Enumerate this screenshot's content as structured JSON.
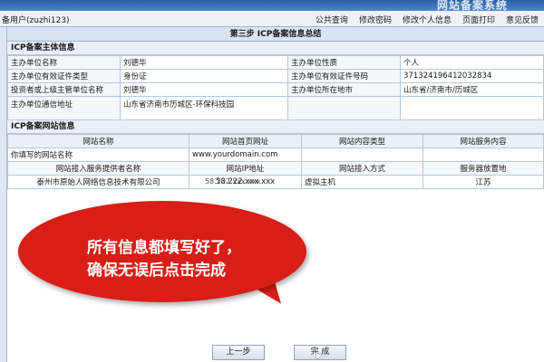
{
  "banner": {
    "title": "网站备案系统"
  },
  "userbar": {
    "user_label": "备用户(zuzhi123)",
    "links": [
      "公共查询",
      "修改密码",
      "修改个人信息",
      "页面打印",
      "意见反馈"
    ]
  },
  "step_title": "第三步  ICP备案信息总结",
  "subject_section": {
    "title": "ICP备案主体信息",
    "rows": [
      [
        "主办单位名称",
        "刘德华",
        "主办单位性质",
        "个人"
      ],
      [
        "主办单位有效证件类型",
        "身份证",
        "主办单位有效证件号码",
        "371324196412032834"
      ],
      [
        "投资者或上级主管单位名称",
        "刘德华",
        "主办单位所在地市",
        "山东省/济南市/历城区"
      ],
      [
        "主办单位通信地址",
        "山东省济南市历城区-环保科技园",
        "",
        ""
      ]
    ]
  },
  "site_section": {
    "title": "ICP备案网站信息",
    "headers": [
      "网站名称",
      "网站首页网址",
      "网站内容类型",
      "网站服务内容"
    ],
    "site_row": [
      "你填写的网站名称",
      "www.yourdomain.com",
      "",
      ""
    ],
    "access_headers": [
      "网站接入服务提供者名称",
      "网站IP地址",
      "网站接入方式",
      "服务器放置地"
    ],
    "access_row": [
      "泰州市原始人网络信息技术有限公司",
      "58.222.xxx.xxx",
      "虚拟主机",
      "江苏"
    ],
    "stray_ip": "58.222.xxx.xxx"
  },
  "callout": {
    "line1": "所有信息都填写好了，",
    "line2": "确保无误后点击完成"
  },
  "buttons": {
    "prev": "上一步",
    "finish": "完 成"
  },
  "colors": {
    "callout": "#d81e16",
    "banner": "#2a5fa8"
  }
}
